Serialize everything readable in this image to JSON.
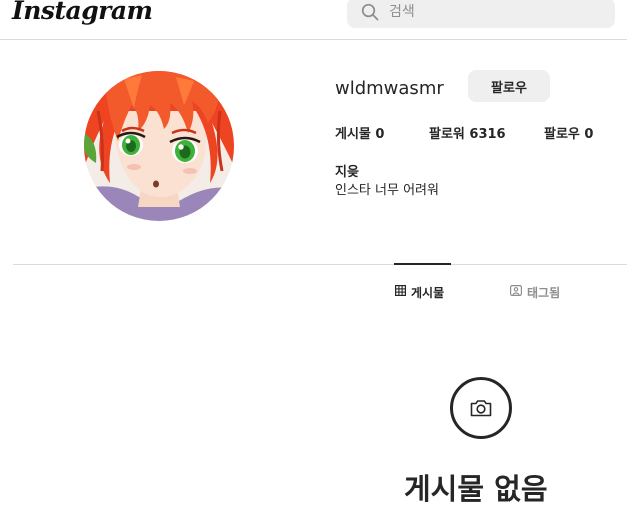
{
  "header": {
    "logo_text": "Instagram",
    "search": {
      "placeholder": "검색",
      "value": ""
    }
  },
  "profile": {
    "username": "wldmwasmr",
    "follow_label": "팔로우",
    "stats": {
      "posts": "게시물 0",
      "followers": "팔로워 6316",
      "following": "팔로우 0"
    },
    "full_name": "지읒",
    "bio": "인스타 너무 어려워"
  },
  "tabs": [
    {
      "label": "게시물",
      "icon": "grid-icon",
      "active": true
    },
    {
      "label": "태그됨",
      "icon": "tagged-icon",
      "active": false
    }
  ],
  "empty_state": {
    "icon": "camera-icon",
    "title": "게시물 없음"
  },
  "colors": {
    "text": "#262626",
    "muted": "#8e8e8e",
    "border": "#dbdbdb",
    "button_bg": "#efefef"
  }
}
